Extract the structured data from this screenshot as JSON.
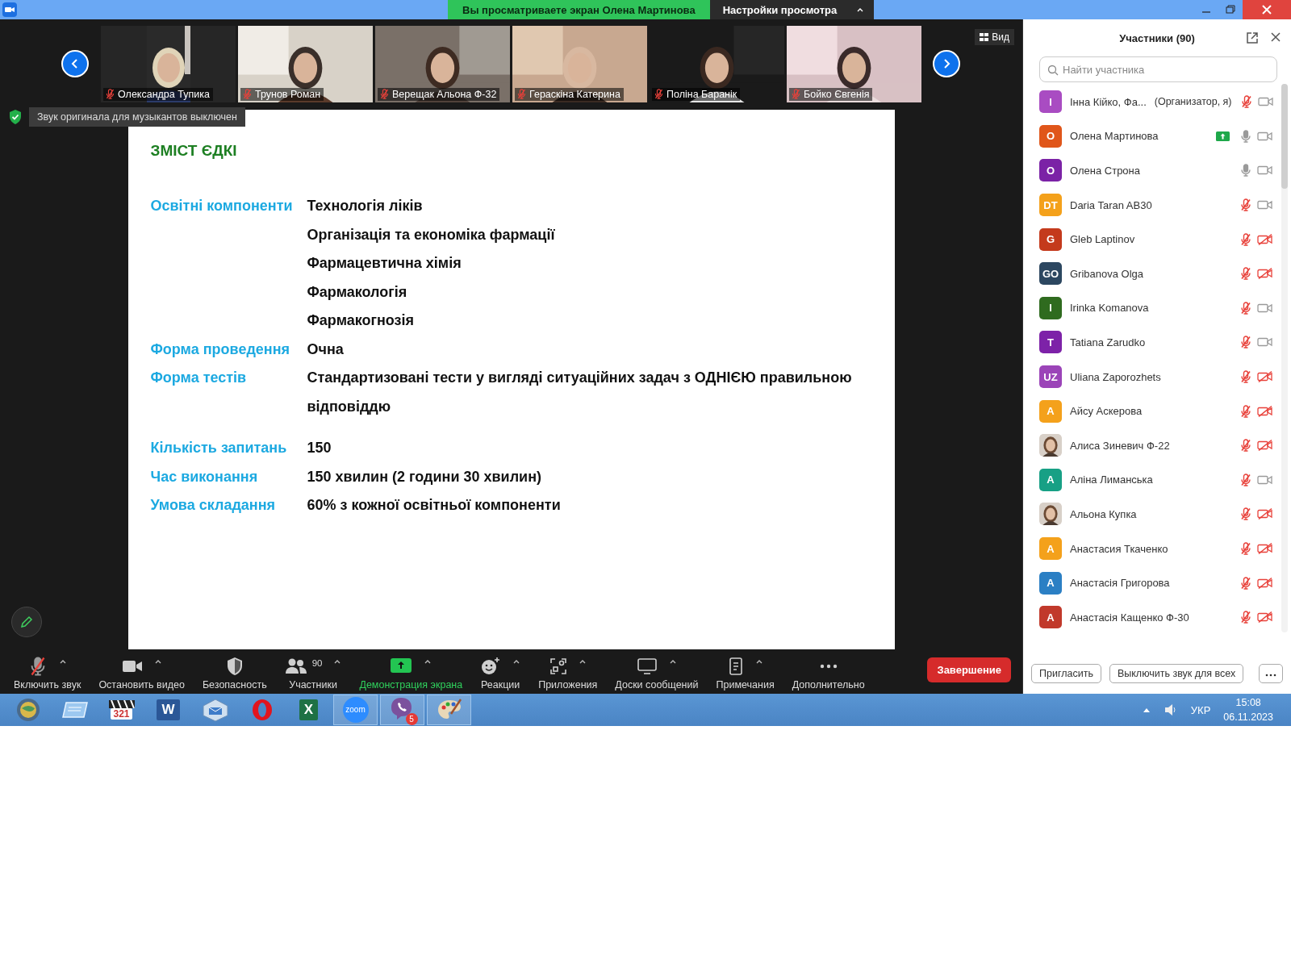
{
  "window": {
    "banner": "Вы просматриваете экран Олена Мартинова",
    "view_settings": "Настройки просмотра"
  },
  "gallery": {
    "view_button": "Вид",
    "tiles": [
      {
        "name": "Олександра Тупика",
        "muted": true
      },
      {
        "name": "Трунов Роман",
        "muted": true
      },
      {
        "name": "Верещак Альона Ф-32",
        "muted": true
      },
      {
        "name": "Гераскіна Катерина",
        "muted": true
      },
      {
        "name": "Поліна Баранік",
        "muted": true
      },
      {
        "name": "Бойко Євгенія",
        "muted": true
      }
    ]
  },
  "notice": "Звук оригинала для музыкантов выключен",
  "slide": {
    "title": "ЗМІСТ ЄДКІ",
    "rows": [
      {
        "label": "Освітні компоненти",
        "values": [
          "Технологія ліків",
          "Організація та економіка фармації",
          "Фармацевтична хімія",
          "Фармакологія",
          "Фармакогнозія"
        ]
      },
      {
        "label": "Форма проведення",
        "values": [
          "Очна"
        ]
      },
      {
        "label": "Форма тестів",
        "values": [
          "Стандартизовані тести у вигляді ситуаційних задач з ОДНІЄЮ правильною відповіддю"
        ]
      },
      {
        "label": "Кількість запитань",
        "values": [
          "150"
        ]
      },
      {
        "label": "Час виконання",
        "values": [
          "150 хвилин (2 години 30 хвилин)"
        ]
      },
      {
        "label": "Умова складання",
        "values": [
          "60% з кожної освітньої компоненти"
        ]
      }
    ]
  },
  "toolbar": {
    "items": [
      {
        "kind": "mic",
        "label": "Включить звук",
        "muted": true,
        "menu": true
      },
      {
        "kind": "video",
        "label": "Остановить видео",
        "menu": true
      },
      {
        "kind": "security",
        "label": "Безопасность",
        "menu": false
      },
      {
        "kind": "participants",
        "label": "Участники",
        "count": "90",
        "menu": true
      },
      {
        "kind": "share",
        "label": "Демонстрация экрана",
        "active": true,
        "menu": true
      },
      {
        "kind": "reactions",
        "label": "Реакции",
        "menu": true
      },
      {
        "kind": "apps",
        "label": "Приложения",
        "menu": true
      },
      {
        "kind": "whiteboards",
        "label": "Доски сообщений",
        "menu": true
      },
      {
        "kind": "notes",
        "label": "Примечания",
        "menu": true
      },
      {
        "kind": "more",
        "label": "Дополнительно",
        "menu": false
      }
    ],
    "end_button": "Завершение"
  },
  "participants": {
    "title": "Участники (90)",
    "search": {
      "placeholder": "Найти участника"
    },
    "items": [
      {
        "kind": "initials",
        "initials": "I",
        "color": "#a94cc2",
        "name": "Інна Кійко, Фа...",
        "role": "(Организатор, я)",
        "sharing": false,
        "mic_muted": true,
        "video_off": false
      },
      {
        "kind": "initials",
        "initials": "O",
        "color": "#e0561a",
        "name": "Олена Мартинова",
        "sharing": true,
        "mic_muted": false,
        "video_off": false
      },
      {
        "kind": "initials",
        "initials": "O",
        "color": "#7b22a6",
        "name": "Олена Строна",
        "sharing": false,
        "mic_muted": false,
        "video_off": false
      },
      {
        "kind": "initials",
        "initials": "DT",
        "color": "#f4a11b",
        "name": "Daria Taran AB30",
        "sharing": false,
        "mic_muted": true,
        "video_off": false
      },
      {
        "kind": "initials",
        "initials": "G",
        "color": "#c43a1c",
        "name": "Gleb Laptinov",
        "sharing": false,
        "mic_muted": true,
        "video_off": true
      },
      {
        "kind": "initials",
        "initials": "GO",
        "color": "#2c4760",
        "name": "Gribanova Olga",
        "sharing": false,
        "mic_muted": true,
        "video_off": true
      },
      {
        "kind": "initials",
        "initials": "I",
        "color": "#2f6b1f",
        "name": "Irinka Komanova",
        "sharing": false,
        "mic_muted": true,
        "video_off": false
      },
      {
        "kind": "initials",
        "initials": "T",
        "color": "#7d22a8",
        "name": "Tatiana Zarudko",
        "sharing": false,
        "mic_muted": true,
        "video_off": false
      },
      {
        "kind": "initials",
        "initials": "UZ",
        "color": "#9b44b8",
        "name": "Uliana Zaporozhets",
        "sharing": false,
        "mic_muted": true,
        "video_off": true
      },
      {
        "kind": "initials",
        "initials": "A",
        "color": "#f4a11b",
        "name": "Айсу Аскерова",
        "sharing": false,
        "mic_muted": true,
        "video_off": true
      },
      {
        "name": "Алиса Зиневич Ф-22",
        "sharing": false,
        "mic_muted": true,
        "video_off": true
      },
      {
        "kind": "initials",
        "initials": "A",
        "color": "#17a085",
        "name": "Аліна Лиманська",
        "sharing": false,
        "mic_muted": true,
        "video_off": false
      },
      {
        "name": "Альона Купка",
        "sharing": false,
        "mic_muted": true,
        "video_off": true
      },
      {
        "kind": "initials",
        "initials": "A",
        "color": "#f4a11b",
        "name": "Анастасия Ткаченко",
        "sharing": false,
        "mic_muted": true,
        "video_off": true
      },
      {
        "kind": "initials",
        "initials": "A",
        "color": "#2b7fc4",
        "name": "Анастасія Григорова",
        "sharing": false,
        "mic_muted": true,
        "video_off": true
      },
      {
        "kind": "initials",
        "initials": "A",
        "color": "#c1392b",
        "name": "Анастасія Кащенко Ф-30",
        "sharing": false,
        "mic_muted": true,
        "video_off": true
      }
    ],
    "buttons": [
      "Пригласить",
      "Выключить звук для всех"
    ]
  },
  "taskbar": {
    "apps": [
      {
        "kind": "system",
        "open": false
      },
      {
        "kind": "files",
        "open": false
      },
      {
        "kind": "media",
        "glyph": "321",
        "open": false
      },
      {
        "kind": "word",
        "glyph": "W",
        "open": false
      },
      {
        "kind": "mail",
        "open": false
      },
      {
        "kind": "opera",
        "open": false
      },
      {
        "kind": "excel",
        "glyph": "X",
        "open": false
      },
      {
        "kind": "zoom",
        "glyph": "zoom",
        "open": true
      },
      {
        "kind": "viber",
        "badge": "5",
        "open": true
      },
      {
        "kind": "paint",
        "open": true
      }
    ],
    "language": "УКР",
    "time": "15:08",
    "date": "06.11.2023"
  }
}
